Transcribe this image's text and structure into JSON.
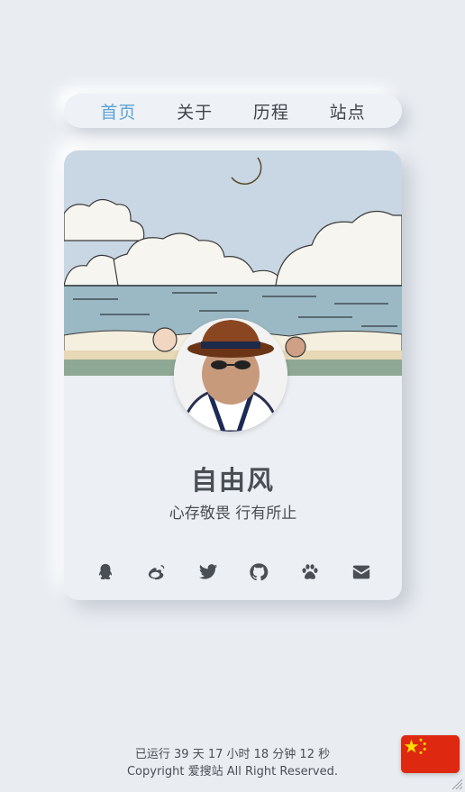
{
  "nav": {
    "items": [
      {
        "label": "首页",
        "active": true
      },
      {
        "label": "关于",
        "active": false
      },
      {
        "label": "历程",
        "active": false
      },
      {
        "label": "站点",
        "active": false
      }
    ]
  },
  "profile": {
    "name": "自由风",
    "motto": "心存敬畏 行有所止"
  },
  "socials": [
    {
      "icon": "qq-icon"
    },
    {
      "icon": "weibo-icon"
    },
    {
      "icon": "twitter-icon"
    },
    {
      "icon": "github-icon"
    },
    {
      "icon": "paw-icon"
    },
    {
      "icon": "email-icon"
    }
  ],
  "footer": {
    "runtime": "已运行 39 天 17 小时 18 分钟 12 秒",
    "copyright": "Copyright 爱搜站 All Right Reserved."
  },
  "colors": {
    "background": "#e9edf2",
    "accent": "#5aa3d6",
    "text": "#4a4f55",
    "flag_red": "#de2910",
    "flag_yellow": "#ffde00"
  }
}
